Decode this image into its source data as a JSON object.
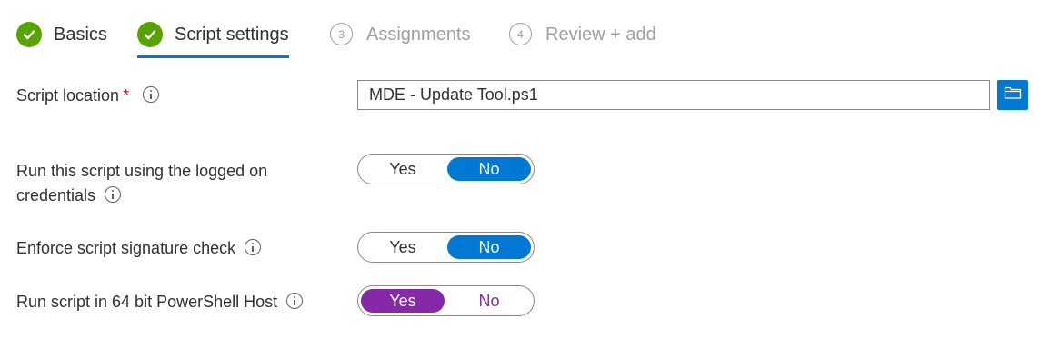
{
  "wizard": {
    "steps": [
      {
        "label": "Basics",
        "state": "complete"
      },
      {
        "label": "Script settings",
        "state": "current"
      },
      {
        "number": "3",
        "label": "Assignments",
        "state": "pending"
      },
      {
        "number": "4",
        "label": "Review + add",
        "state": "pending"
      }
    ]
  },
  "form": {
    "script_location": {
      "label": "Script location",
      "required_mark": "*",
      "value": "MDE - Update Tool.ps1",
      "browse_icon": "folder-icon"
    },
    "logged_on_credentials": {
      "label_line1": "Run this script using the logged on",
      "label_line2": "credentials",
      "options": [
        "Yes",
        "No"
      ],
      "selected": "No"
    },
    "signature_check": {
      "label": "Enforce script signature check",
      "options": [
        "Yes",
        "No"
      ],
      "selected": "No"
    },
    "powershell_64bit": {
      "label": "Run script in 64 bit PowerShell Host",
      "options": [
        "Yes",
        "No"
      ],
      "selected": "Yes"
    }
  },
  "colors": {
    "accent_blue": "#0078d4",
    "complete_green": "#57a300",
    "purple_selected": "#8529a8",
    "required_red": "#a4262c"
  }
}
